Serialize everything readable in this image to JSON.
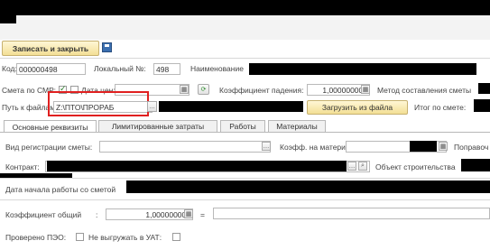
{
  "toolbar": {
    "save_close_label": "Записать и закрыть"
  },
  "form": {
    "code_label": "Код:",
    "code_value": "000000498",
    "local_no_label": "Локальный №:",
    "local_no_value": "498",
    "name_label": "Наименование",
    "smr_estimate_label": "Смета по СМР:",
    "smr_estimate_checked": true,
    "price_date_label": "Дата цен:",
    "decline_coef_label": "Коэффициент падения:",
    "decline_coef_value": "1,000000000",
    "estimate_method_label": "Метод составления сметы",
    "file_path_label": "Путь к файлам:",
    "file_path_value": "Z:\\ПТО\\ПРОРАБ",
    "load_from_file_label": "Загрузить из файла",
    "estimate_total_label": "Итог по смете:"
  },
  "tabs": [
    {
      "label": "Основные реквизиты",
      "active": true
    },
    {
      "label": "Лимитированные затраты",
      "active": false
    },
    {
      "label": "Работы",
      "active": false
    },
    {
      "label": "Материалы",
      "active": false
    }
  ],
  "main": {
    "registration_type_label": "Вид регистрации сметы:",
    "materials_coef_label": "Коэфф. на материалы:",
    "corrections_label": "Поправоч",
    "contract_label": "Контракт:",
    "construction_object_label": "Объект строительства",
    "work_start_date_label": "Дата начала работы со сметой",
    "overall_coef_label": "Коэффициент общий",
    "overall_coef_colon": ":",
    "overall_coef_value": "1,000000000",
    "equals_sign": "=",
    "checked_pto_label": "Проверено ПЭО:",
    "no_upload_uat_label": "Не выгружать в УАТ:"
  },
  "icons": {
    "save": "floppy-disk-icon",
    "calendar": "calendar-icon",
    "refresh": "refresh-icon",
    "select": "ellipsis-icon",
    "search": "magnifier-icon"
  },
  "colors": {
    "highlight": "#e02020",
    "button": "#f3df95"
  }
}
